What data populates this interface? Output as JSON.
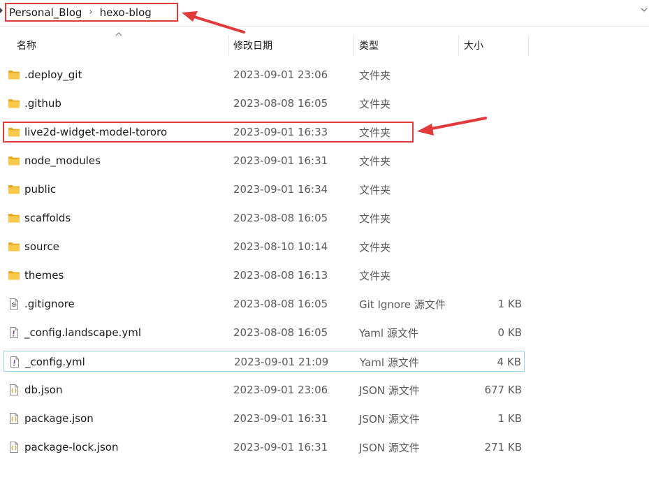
{
  "breadcrumb": {
    "items": [
      "Personal_Blog",
      "hexo-blog"
    ],
    "separator": "›"
  },
  "columns": {
    "name": "名称",
    "modified": "修改日期",
    "type": "类型",
    "size": "大小"
  },
  "files": [
    {
      "name": ".deploy_git",
      "modified": "2023-09-01 23:06",
      "type": "文件夹",
      "size": "",
      "icon": "folder-icon"
    },
    {
      "name": ".github",
      "modified": "2023-08-08 16:05",
      "type": "文件夹",
      "size": "",
      "icon": "folder-icon"
    },
    {
      "name": "live2d-widget-model-tororo",
      "modified": "2023-09-01 16:33",
      "type": "文件夹",
      "size": "",
      "icon": "folder-icon"
    },
    {
      "name": "node_modules",
      "modified": "2023-09-01 16:31",
      "type": "文件夹",
      "size": "",
      "icon": "folder-icon"
    },
    {
      "name": "public",
      "modified": "2023-09-01 16:34",
      "type": "文件夹",
      "size": "",
      "icon": "folder-icon"
    },
    {
      "name": "scaffolds",
      "modified": "2023-08-08 16:05",
      "type": "文件夹",
      "size": "",
      "icon": "folder-icon"
    },
    {
      "name": "source",
      "modified": "2023-08-10 10:14",
      "type": "文件夹",
      "size": "",
      "icon": "folder-icon"
    },
    {
      "name": "themes",
      "modified": "2023-08-08 16:13",
      "type": "文件夹",
      "size": "",
      "icon": "folder-icon"
    },
    {
      "name": ".gitignore",
      "modified": "2023-08-08 16:05",
      "type": "Git Ignore 源文件",
      "size": "1 KB",
      "icon": "gear-file-icon"
    },
    {
      "name": "_config.landscape.yml",
      "modified": "2023-08-08 16:05",
      "type": "Yaml 源文件",
      "size": "0 KB",
      "icon": "yaml-file-icon"
    },
    {
      "name": "_config.yml",
      "modified": "2023-09-01 21:09",
      "type": "Yaml 源文件",
      "size": "4 KB",
      "icon": "yaml-file-icon"
    },
    {
      "name": "db.json",
      "modified": "2023-09-01 23:06",
      "type": "JSON 源文件",
      "size": "677 KB",
      "icon": "json-file-icon"
    },
    {
      "name": "package.json",
      "modified": "2023-09-01 16:31",
      "type": "JSON 源文件",
      "size": "1 KB",
      "icon": "json-file-icon"
    },
    {
      "name": "package-lock.json",
      "modified": "2023-09-01 16:31",
      "type": "JSON 源文件",
      "size": "271 KB",
      "icon": "json-file-icon"
    }
  ],
  "colors": {
    "annotation": "#e03a3a",
    "selection_border": "#99d1e8",
    "folder": "#f5c33b"
  }
}
